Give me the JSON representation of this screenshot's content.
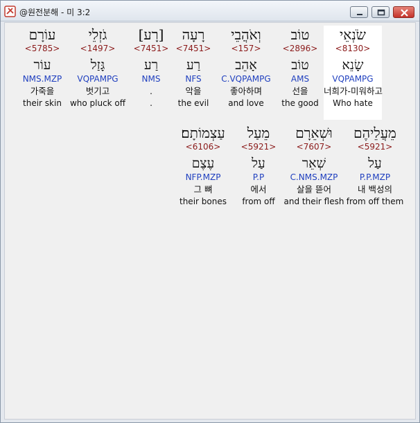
{
  "window": {
    "title": "@원전분해 - 미 3:2"
  },
  "rows": [
    {
      "words": [
        {
          "heb": "שֹׂנְאֵי",
          "strong": "<8130>",
          "lemma": "שָׂנֵא",
          "morph": "VQPAMPG",
          "kor": "너희가-미워하고",
          "eng": "Who hate",
          "highlight": true
        },
        {
          "heb": "טוֹב",
          "strong": "<2896>",
          "lemma": "טוֹב",
          "morph": "AMS",
          "kor": "선을",
          "eng": "the good",
          "highlight": false
        },
        {
          "heb": "וְאֹהֲבֵי",
          "strong": "<157>",
          "lemma": "אָהֵב",
          "morph": "C.VQPAMPG",
          "kor": "좋아하며",
          "eng": "and love",
          "highlight": false
        },
        {
          "heb": "רָעָה",
          "strong": "<7451>",
          "lemma": "רַע",
          "morph": "NFS",
          "kor": "악을",
          "eng": "the evil",
          "highlight": false
        },
        {
          "heb": "[רָע]",
          "strong": "<7451>",
          "lemma": "רַע",
          "morph": "NMS",
          "kor": ".",
          "eng": ".",
          "highlight": false
        },
        {
          "heb": "גֹזְלֵי",
          "strong": "<1497>",
          "lemma": "גָּזַל",
          "morph": "VQPAMPG",
          "kor": "벗기고",
          "eng": "who pluck off",
          "highlight": false
        },
        {
          "heb": "עוֹרָם",
          "strong": "<5785>",
          "lemma": "עוֹר",
          "morph": "NMS.MZP",
          "kor": "가죽을",
          "eng": "their skin",
          "highlight": false
        }
      ]
    },
    {
      "words": [
        {
          "heb": "מֵעֲלֵיהֶם",
          "strong": "<5921>",
          "lemma": "עַל",
          "morph": "P.P.MZP",
          "kor": "내 백성의",
          "eng": "from off them",
          "highlight": false
        },
        {
          "heb": "וּשְׁאֵרָם",
          "strong": "<7607>",
          "lemma": "שְׁאֵר",
          "morph": "C.NMS.MZP",
          "kor": "살을 뜯어",
          "eng": "and their flesh",
          "highlight": false
        },
        {
          "heb": "מֵעַל",
          "strong": "<5921>",
          "lemma": "עַל",
          "morph": "P.P",
          "kor": "에서",
          "eng": "from off",
          "highlight": false
        },
        {
          "heb": "עַצְמוֹתָם׃",
          "strong": "<6106>",
          "lemma": "עֶצֶם",
          "morph": "NFP.MZP",
          "kor": "그 뼈",
          "eng": "their bones",
          "highlight": false
        }
      ]
    }
  ]
}
